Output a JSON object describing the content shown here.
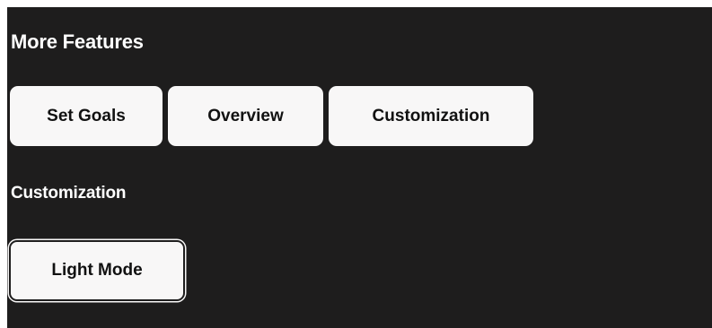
{
  "more_features": {
    "title": "More Features",
    "buttons": {
      "set_goals": "Set Goals",
      "overview": "Overview",
      "customization": "Customization"
    }
  },
  "customization": {
    "title": "Customization",
    "light_mode_label": "Light Mode"
  },
  "colors": {
    "panel_background": "#1e1d1d",
    "button_background": "#f8f7f7",
    "title_text": "#ffffff",
    "button_text": "#111111"
  }
}
